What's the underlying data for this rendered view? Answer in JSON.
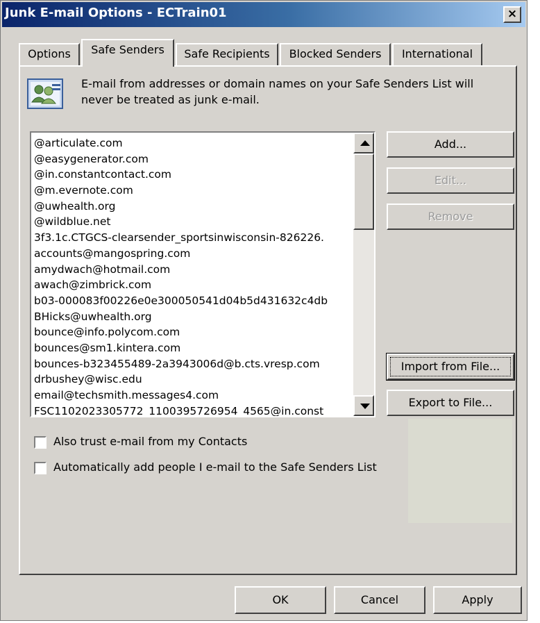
{
  "window": {
    "title": "Junk E-mail Options - ECTrain01",
    "close_glyph": "×"
  },
  "tabs": [
    {
      "label": "Options",
      "active": false
    },
    {
      "label": "Safe Senders",
      "active": true
    },
    {
      "label": "Safe Recipients",
      "active": false
    },
    {
      "label": "Blocked Senders",
      "active": false
    },
    {
      "label": "International",
      "active": false
    }
  ],
  "info": {
    "icon": "contacts-icon",
    "text_line1": "E-mail from addresses or domain names on your Safe Senders List will",
    "text_line2": "never be treated as junk e-mail."
  },
  "safe_senders": [
    "@articulate.com",
    "@easygenerator.com",
    "@in.constantcontact.com",
    "@m.evernote.com",
    "@uwhealth.org",
    "@wildblue.net",
    "3f3.1c.CTGCS-clearsender_sportsinwisconsin-826226.",
    "accounts@mangospring.com",
    "amydwach@hotmail.com",
    "awach@zimbrick.com",
    "b03-000083f00226e0e300050541d04b5d431632c4db",
    "BHicks@uwhealth.org",
    "bounce@info.polycom.com",
    "bounces@sm1.kintera.com",
    "bounces-b323455489-2a3943006d@b.cts.vresp.com",
    "drbushey@wisc.edu",
    "email@techsmith.messages4.com",
    "FSC1102023305772_1100395726954_4565@in.const"
  ],
  "buttons": {
    "add": "Add...",
    "edit": "Edit...",
    "remove": "Remove",
    "import": "Import from File...",
    "export": "Export to File...",
    "ok": "OK",
    "cancel": "Cancel",
    "apply": "Apply"
  },
  "checkboxes": {
    "trust_contacts": {
      "label": "Also trust e-mail from my Contacts",
      "checked": false
    },
    "auto_add": {
      "label": "Automatically add people I e-mail to the Safe Senders List",
      "checked": false
    }
  }
}
